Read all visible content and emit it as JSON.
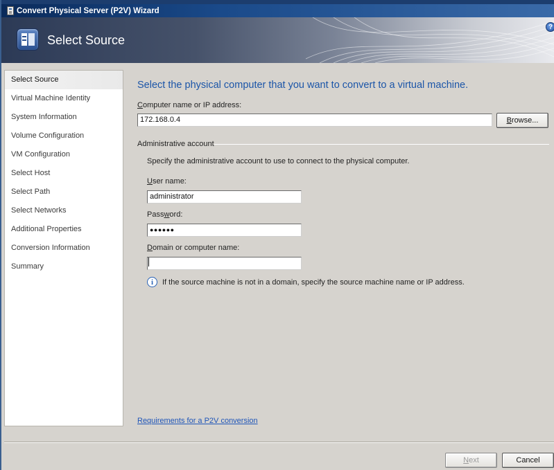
{
  "window": {
    "title": "Convert Physical Server (P2V) Wizard"
  },
  "banner": {
    "title": "Select Source",
    "help_glyph": "?"
  },
  "sidebar": {
    "items": [
      {
        "label": "Select Source",
        "active": true
      },
      {
        "label": "Virtual Machine Identity",
        "active": false
      },
      {
        "label": "System Information",
        "active": false
      },
      {
        "label": "Volume Configuration",
        "active": false
      },
      {
        "label": "VM Configuration",
        "active": false
      },
      {
        "label": "Select Host",
        "active": false
      },
      {
        "label": "Select Path",
        "active": false
      },
      {
        "label": "Select Networks",
        "active": false
      },
      {
        "label": "Additional Properties",
        "active": false
      },
      {
        "label": "Conversion Information",
        "active": false
      },
      {
        "label": "Summary",
        "active": false
      }
    ]
  },
  "main": {
    "heading": "Select the physical computer that you want to convert to a virtual machine.",
    "computer_name": {
      "label_underlined": "C",
      "label_rest": "omputer name or IP address:",
      "value": "172.168.0.4"
    },
    "browse_button": {
      "label_underlined": "B",
      "label_rest": "rowse..."
    },
    "admin_group": {
      "title": "Administrative account",
      "description": "Specify the administrative account to use to connect to the physical computer.",
      "user_name": {
        "label_underlined": "U",
        "label_rest": "ser name:",
        "value": "administrator"
      },
      "password": {
        "label_pre": "Pass",
        "label_underlined": "w",
        "label_rest": "ord:",
        "value": "●●●●●●"
      },
      "domain": {
        "label_underlined": "D",
        "label_rest": "omain or computer name:",
        "value": ""
      },
      "info_glyph": "i",
      "info_text": "If the source machine is not in a domain, specify the source machine name or IP address."
    },
    "requirements_link": "Requirements for a P2V conversion"
  },
  "footer": {
    "next_button": {
      "label_underlined": "N",
      "label_rest": "ext",
      "enabled": false
    },
    "cancel_button": {
      "label": "Cancel"
    }
  },
  "colors": {
    "heading": "#1b55a8",
    "link": "#1f55b8",
    "title_bar": "#0a2a5a"
  }
}
